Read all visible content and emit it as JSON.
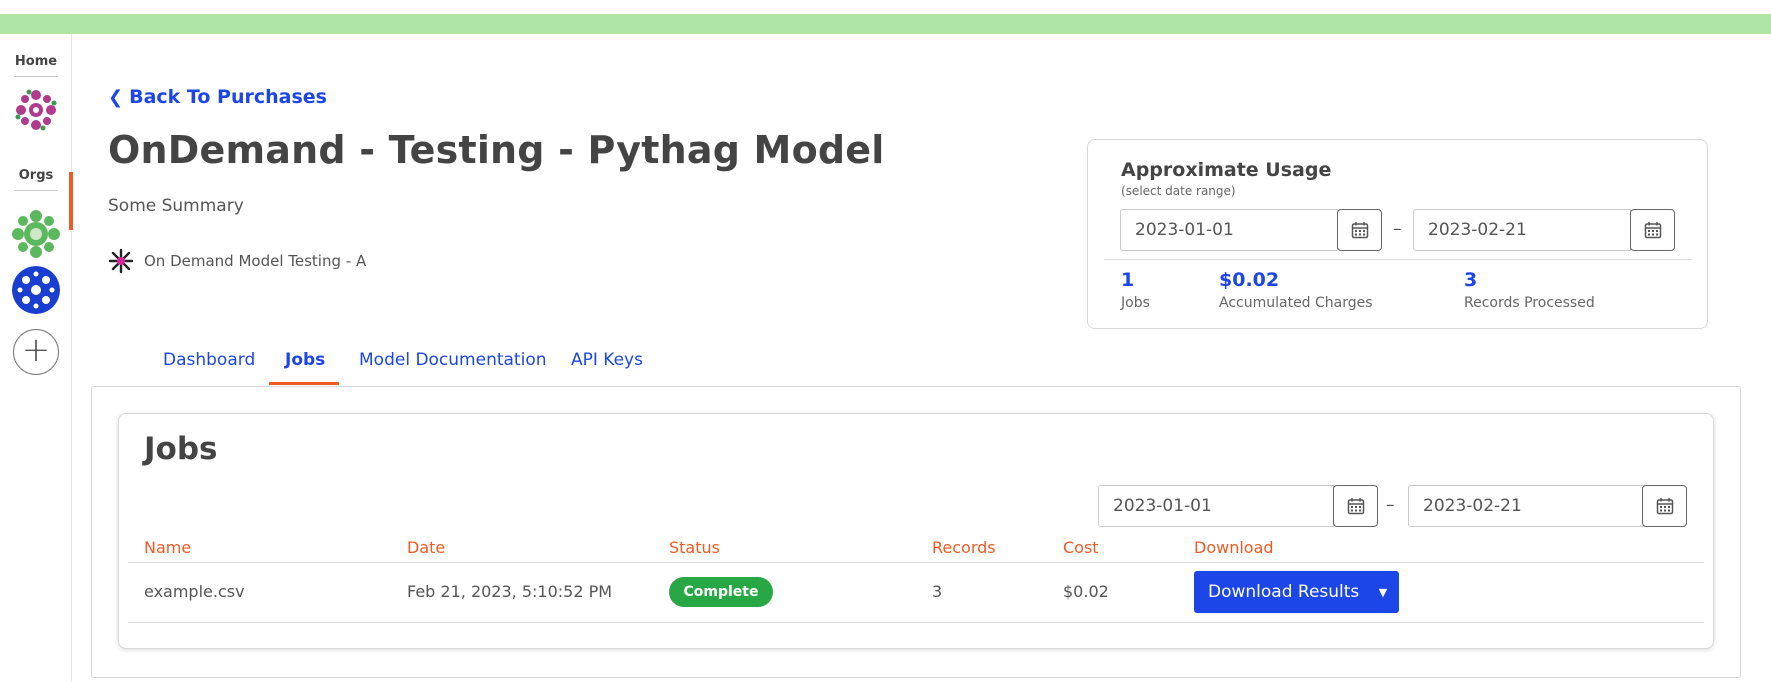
{
  "sidebar": {
    "home_label": "Home",
    "orgs_label": "Orgs",
    "add_label": "+"
  },
  "back_link": "Back To Purchases",
  "title": "OnDemand - Testing - Pythag Model",
  "summary": "Some Summary",
  "org_name": "On Demand Model Testing - A",
  "usage": {
    "title": "Approximate Usage",
    "subtitle": "(select date range)",
    "start_date": "2023-01-01",
    "end_date": "2023-02-21",
    "separator": "–",
    "stats": [
      {
        "value": "1",
        "label": "Jobs"
      },
      {
        "value": "$0.02",
        "label": "Accumulated Charges"
      },
      {
        "value": "3",
        "label": "Records Processed"
      }
    ]
  },
  "tabs": [
    {
      "label": "Dashboard",
      "active": false
    },
    {
      "label": "Jobs",
      "active": true
    },
    {
      "label": "Model Documentation",
      "active": false
    },
    {
      "label": "API Keys",
      "active": false
    }
  ],
  "jobs": {
    "title": "Jobs",
    "start_date": "2023-01-01",
    "end_date": "2023-02-21",
    "separator": "–",
    "columns": [
      "Name",
      "Date",
      "Status",
      "Records",
      "Cost",
      "Download"
    ],
    "rows": [
      {
        "name": "example.csv",
        "date": "Feb 21, 2023, 5:10:52 PM",
        "status": "Complete",
        "records": "3",
        "cost": "$0.02",
        "download_label": "Download Results"
      }
    ]
  },
  "colors": {
    "accent": "#1c46e8",
    "highlight": "#f15a24",
    "success": "#27a844",
    "topbar": "#aee4a4"
  }
}
